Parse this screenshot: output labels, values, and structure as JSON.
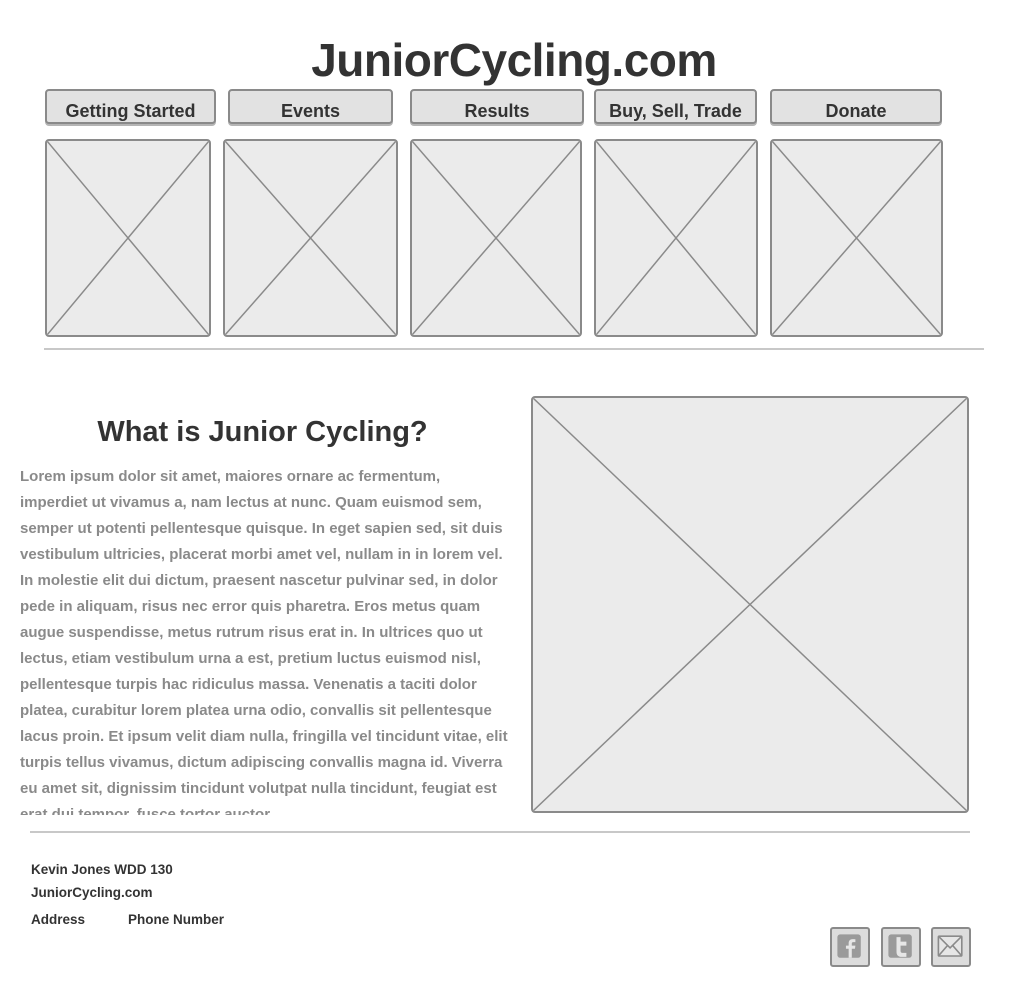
{
  "site": {
    "title": "JuniorCycling.com"
  },
  "nav": {
    "items": [
      {
        "label": "Getting Started"
      },
      {
        "label": "Events"
      },
      {
        "label": "Results"
      },
      {
        "label": "Buy, Sell, Trade"
      },
      {
        "label": "Donate"
      }
    ]
  },
  "content": {
    "heading": "What is Junior Cycling?",
    "body": "Lorem ipsum dolor sit amet, maiores ornare ac fermentum, imperdiet ut vivamus a, nam lectus at nunc. Quam euismod sem, semper ut potenti pellentesque quisque. In eget sapien sed, sit duis vestibulum ultricies, placerat morbi amet vel, nullam in in lorem vel. In molestie elit dui dictum, praesent nascetur pulvinar sed, in dolor pede in aliquam, risus nec error quis pharetra. Eros metus quam augue suspendisse, metus rutrum risus erat in.  In ultrices quo ut lectus, etiam vestibulum urna a est, pretium luctus euismod nisl, pellentesque turpis hac ridiculus massa. Venenatis a taciti dolor platea, curabitur lorem platea urna odio, convallis sit pellentesque lacus proin. Et ipsum velit diam nulla, fringilla vel tincidunt vitae, elit turpis tellus vivamus, dictum adipiscing convallis magna id. Viverra eu amet sit, dignissim tincidunt volutpat nulla tincidunt, feugiat est erat dui tempor, fusce tortor auctor"
  },
  "footer": {
    "author": "Kevin Jones WDD 130",
    "site": "JuniorCycling.com",
    "address_label": "Address",
    "phone_label": "Phone Number",
    "social": [
      {
        "icon": "facebook-icon"
      },
      {
        "icon": "twitter-icon"
      },
      {
        "icon": "email-icon"
      }
    ]
  },
  "colors": {
    "border": "#8a8a8a",
    "placeholder_fill": "#ebebeb",
    "button_fill": "#e2e2e2",
    "heading_text": "#333333",
    "body_text": "#8a8a8a",
    "divider": "#c8c8c8"
  }
}
